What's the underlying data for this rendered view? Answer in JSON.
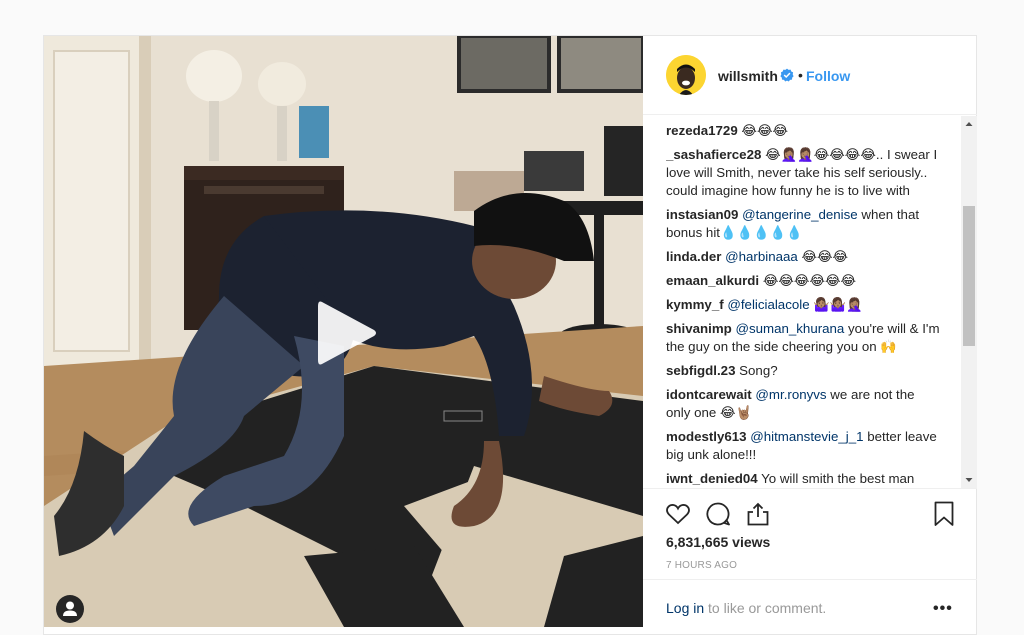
{
  "header": {
    "username": "willsmith",
    "follow_label": "Follow",
    "dot": "•"
  },
  "comments": [
    {
      "user": "rezeda1729",
      "mention": "",
      "text": " 😂😂😂"
    },
    {
      "user": "_sashafierce28",
      "mention": "",
      "text": " 😂🤦🏽‍♀️🤦🏽‍♀️😂😂😂😂.. I swear I love will Smith, never take his self seriously.. could imagine how funny he is to live with"
    },
    {
      "user": "instasian09",
      "mention": "@tangerine_denise",
      "text": " when that bonus hit💧💧💧💧💧"
    },
    {
      "user": "linda.der",
      "mention": "@harbinaaa",
      "text": " 😂😂😂"
    },
    {
      "user": "emaan_alkurdi",
      "mention": "",
      "text": " 😂😂😂😂😂😂"
    },
    {
      "user": "kymmy_f",
      "mention": "@felicialacole",
      "text": " 🤷🏽‍♀️🤷🏽‍♀️🤦🏽‍♀️"
    },
    {
      "user": "shivanimp",
      "mention": "@suman_khurana",
      "text": " you're will & I'm the guy on the side cheering you on 🙌"
    },
    {
      "user": "sebfigdl.23",
      "mention": "",
      "text": " Song?"
    },
    {
      "user": "idontcarewait",
      "mention": "@mr.ronyvs",
      "text": " we are not the only one 😂🤘🏽"
    },
    {
      "user": "modestly613",
      "mention": "@hitmanstevie_j_1",
      "text": " better leave big unk alone!!!"
    },
    {
      "user": "iwnt_denied04",
      "mention": "",
      "text": " Yo will smith the best man"
    }
  ],
  "views": "6,831,665 views",
  "time": "7 HOURS AGO",
  "footer": {
    "login_link": "Log in",
    "login_rest": " to like or comment.",
    "more": "•••"
  },
  "colors": {
    "accent": "#3897f0",
    "mention": "#003569",
    "avatar_bg": "#fcd531"
  },
  "icons": [
    "play-icon",
    "user-tag-icon",
    "verified-badge-icon",
    "heart-icon",
    "comment-icon",
    "share-icon",
    "bookmark-icon",
    "more-options-icon"
  ]
}
